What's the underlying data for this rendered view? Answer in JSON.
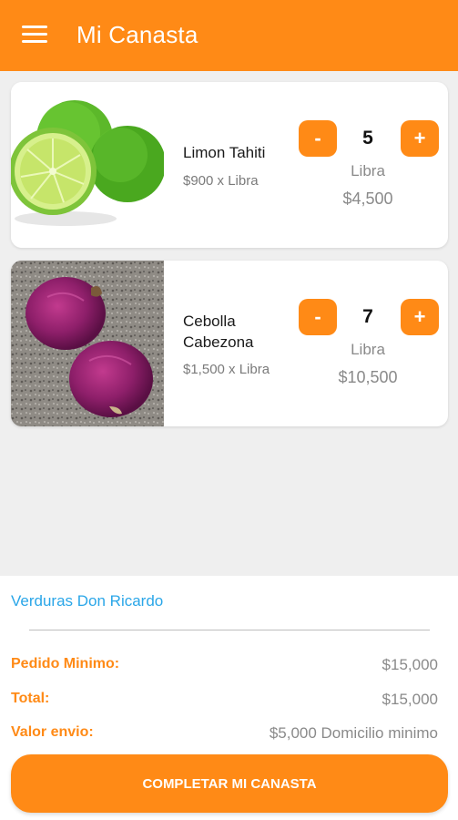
{
  "appbar": {
    "title": "Mi Canasta",
    "menu_icon": "menu-icon"
  },
  "cart": {
    "items": [
      {
        "name": "Limon Tahiti",
        "unit_price": "$900 x Libra",
        "quantity": "5",
        "unit": "Libra",
        "subtotal": "$4,500",
        "minus_label": "-",
        "plus_label": "+"
      },
      {
        "name": "Cebolla Cabezona",
        "unit_price": "$1,500 x Libra",
        "quantity": "7",
        "unit": "Libra",
        "subtotal": "$10,500",
        "minus_label": "-",
        "plus_label": "+"
      }
    ]
  },
  "summary": {
    "store_name": "Verduras Don Ricardo",
    "minimum_order_label": "Pedido Minimo:",
    "minimum_order_value": "$15,000",
    "total_label": "Total:",
    "total_value": "$15,000",
    "shipping_label": "Valor envio:",
    "shipping_value": "$5,000 Domicilio minimo",
    "cta_label": "COMPLETAR MI CANASTA"
  },
  "colors": {
    "accent": "#ff8a16",
    "link": "#2aa6e8",
    "background": "#efefef"
  }
}
